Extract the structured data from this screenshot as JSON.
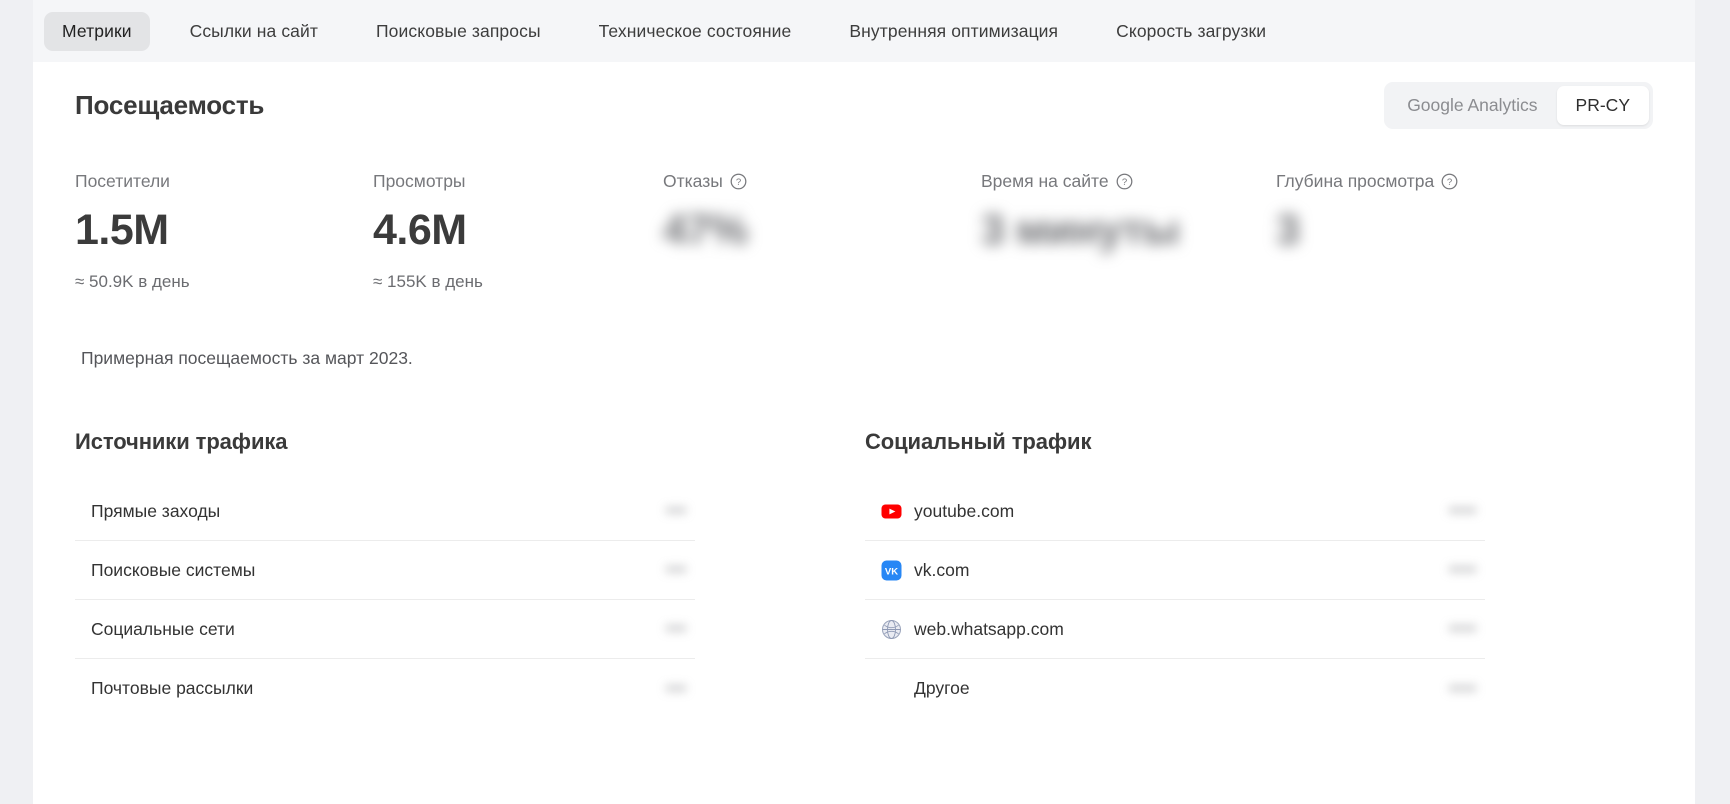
{
  "tabs": [
    {
      "label": "Метрики",
      "active": true
    },
    {
      "label": "Ссылки на сайт",
      "active": false
    },
    {
      "label": "Поисковые запросы",
      "active": false
    },
    {
      "label": "Техническое состояние",
      "active": false
    },
    {
      "label": "Внутренняя оптимизация",
      "active": false
    },
    {
      "label": "Скорость загрузки",
      "active": false
    }
  ],
  "section": {
    "title": "Посещаемость",
    "source_toggle": {
      "options": [
        "Google Analytics",
        "PR-CY"
      ],
      "selected": "PR-CY"
    }
  },
  "metrics": [
    {
      "label": "Посетители",
      "value": "1.5M",
      "sub": "≈ 50.9K в день",
      "has_help": false,
      "hidden": false
    },
    {
      "label": "Просмотры",
      "value": "4.6M",
      "sub": "≈ 155K в день",
      "has_help": false,
      "hidden": false
    },
    {
      "label": "Отказы",
      "value": "47%",
      "sub": "",
      "has_help": true,
      "hidden": true
    },
    {
      "label": "Время на сайте",
      "value": "3 минуты",
      "sub": "",
      "has_help": true,
      "hidden": true
    },
    {
      "label": "Глубина просмотра",
      "value": "3",
      "sub": "",
      "has_help": true,
      "hidden": true
    }
  ],
  "note": "Примерная посещаемость за март 2023.",
  "traffic_sources": {
    "title": "Источники трафика",
    "rows": [
      {
        "label": "Прямые заходы",
        "value": "•••"
      },
      {
        "label": "Поисковые системы",
        "value": "•••"
      },
      {
        "label": "Социальные сети",
        "value": "•••"
      },
      {
        "label": "Почтовые рассылки",
        "value": "•••"
      }
    ]
  },
  "social_traffic": {
    "title": "Социальный трафик",
    "rows": [
      {
        "label": "youtube.com",
        "value": "••••",
        "icon": "youtube-icon"
      },
      {
        "label": "vk.com",
        "value": "••••",
        "icon": "vk-icon"
      },
      {
        "label": "web.whatsapp.com",
        "value": "••••",
        "icon": "globe-icon"
      },
      {
        "label": "Другое",
        "value": "••••",
        "icon": "none"
      }
    ]
  },
  "colors": {
    "page_bg": "#eff0f3",
    "card_bg": "#ffffff",
    "tabbar_bg": "#f5f6f8",
    "tab_active_bg": "#e3e4e6",
    "text_primary": "#3a3a3a",
    "text_muted": "#77787c",
    "youtube_red": "#ff0000",
    "vk_blue": "#2787f5"
  }
}
